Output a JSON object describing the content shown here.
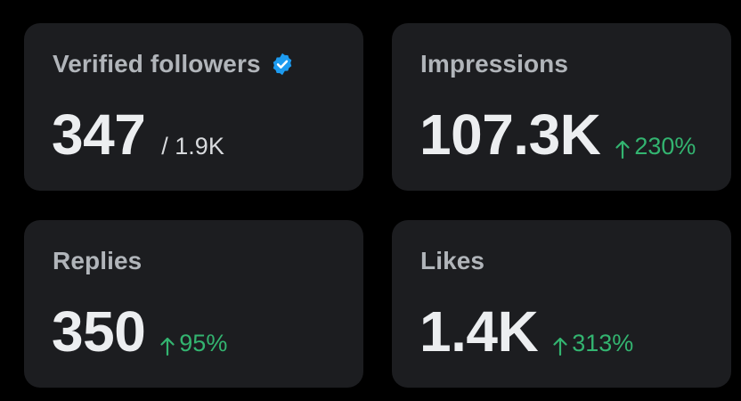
{
  "colors": {
    "background": "#000000",
    "card": "#1c1d20",
    "title": "#b1b5ba",
    "value": "#eceef0",
    "positive": "#33b470",
    "verified": "#1d9bf0"
  },
  "cards": [
    {
      "title": "Verified followers",
      "icon": "verified-badge-icon",
      "value": "347",
      "sub_total": "/ 1.9K"
    },
    {
      "title": "Impressions",
      "value": "107.3K",
      "change": "230%",
      "change_icon": "arrow-up-icon"
    },
    {
      "title": "Replies",
      "value": "350",
      "change": "95%",
      "change_icon": "arrow-up-icon"
    },
    {
      "title": "Likes",
      "value": "1.4K",
      "change": "313%",
      "change_icon": "arrow-up-icon"
    }
  ]
}
